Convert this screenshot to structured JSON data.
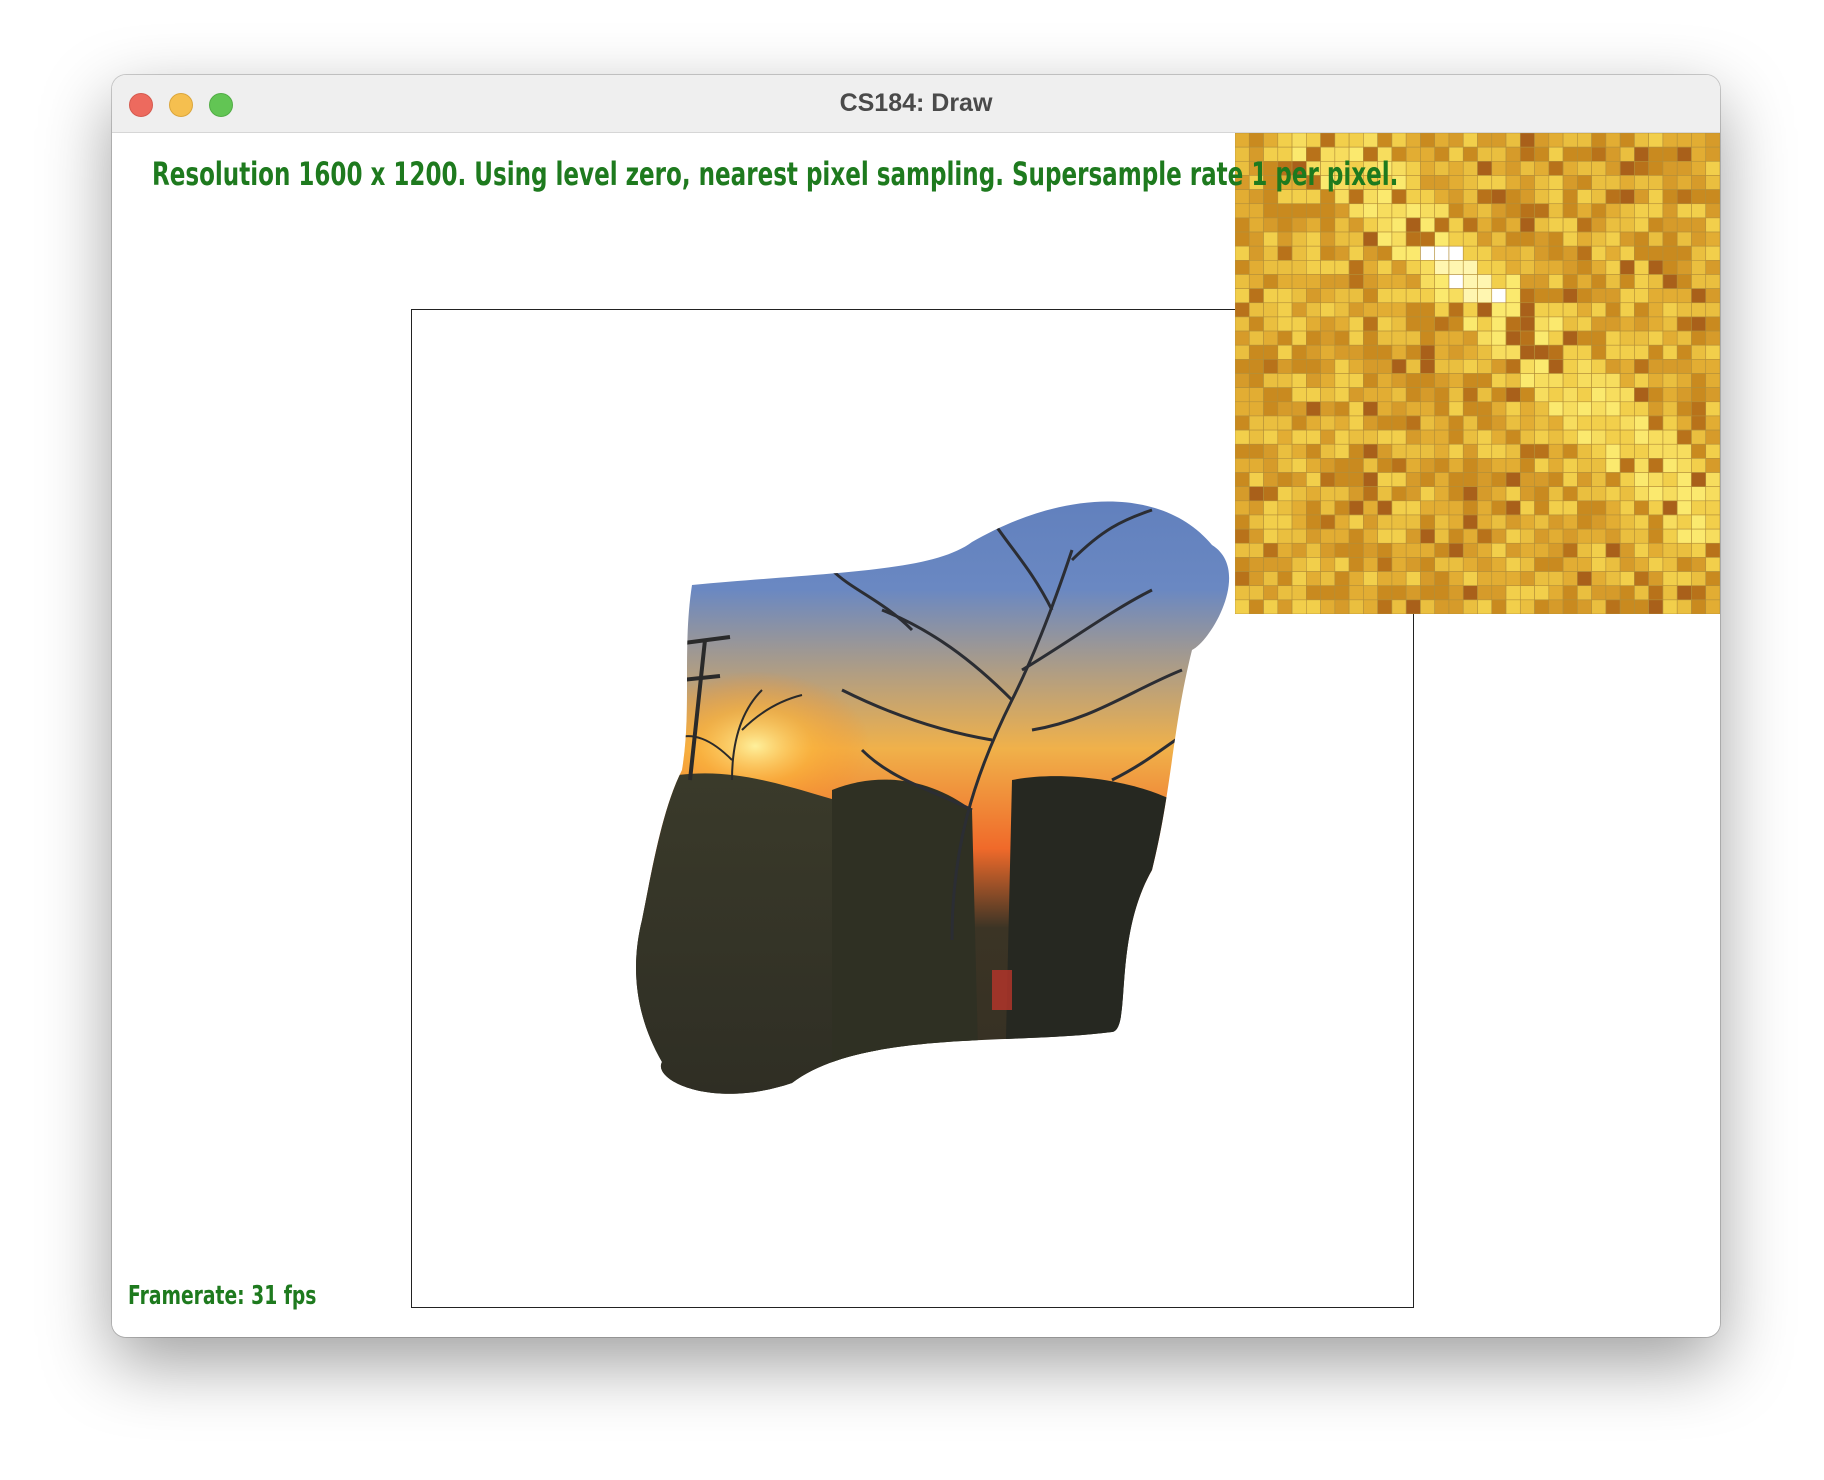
{
  "window": {
    "title": "CS184: Draw",
    "controls": [
      "close",
      "minimize",
      "zoom"
    ]
  },
  "overlay": {
    "status": "Resolution 1600 x 1200. Using level zero, nearest pixel sampling. Supersample rate 1 per pixel.",
    "framerate": "Framerate: 31 fps"
  },
  "colors": {
    "status_text": "#1e7a1e",
    "close": "#ed6a5e",
    "minimize": "#f5bf4f",
    "zoom": "#62c554",
    "zoom_base": "#d9a52e"
  },
  "canvas": {
    "content": "texture-mapped sunset photo (power pole, bare trees) on a warped quad",
    "zoom_panel": "pixel inspector grid of yellow/orange pixels"
  }
}
